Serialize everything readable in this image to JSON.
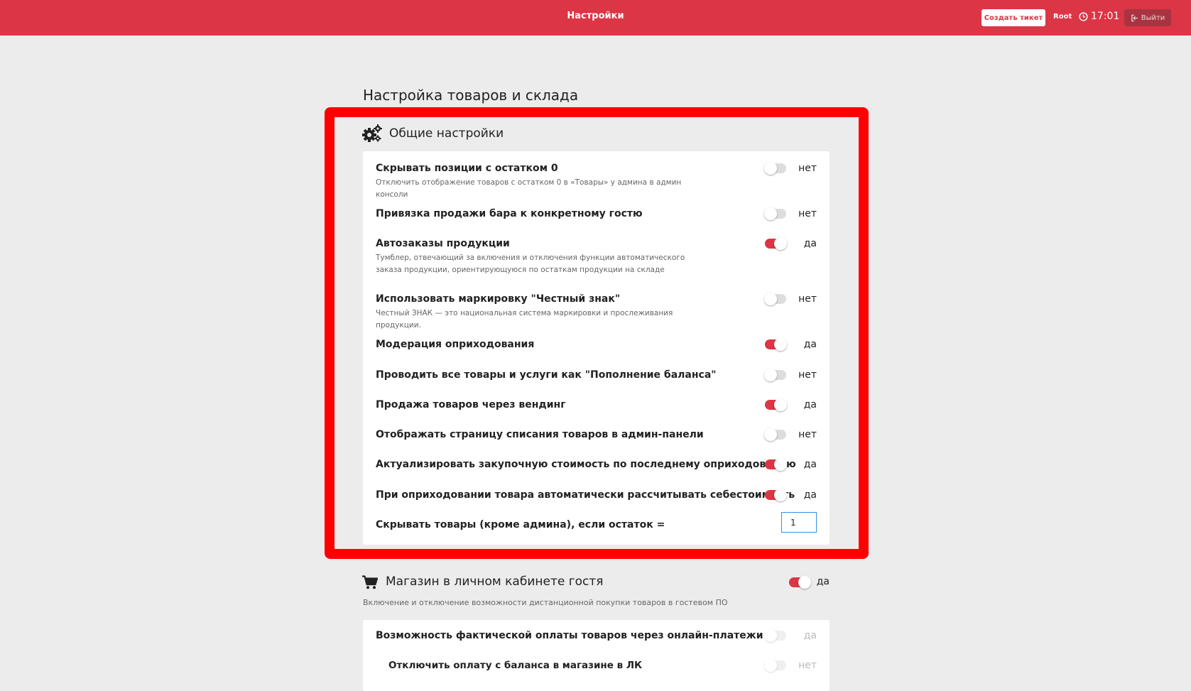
{
  "header": {
    "title": "Настройки",
    "create_ticket": "Создать тикет",
    "user": "Root",
    "time": "17:01",
    "logout": "Выйти"
  },
  "page_title": "Настройка товаров и склада",
  "general": {
    "title": "Общие настройки",
    "rows": [
      {
        "label": "Скрывать позиции с остатком 0",
        "desc": "Отключить отображение товаров с остатком 0 в «Товары» у админа в админ консоли",
        "state": "нет"
      },
      {
        "label": "Привязка продажи бара к конкретному гостю",
        "desc": "",
        "state": "нет"
      },
      {
        "label": "Автозаказы продукции",
        "desc": "Тумблер, отвечающий за включения и отключения функции автоматического заказа продукции, ориентирующуюся по остаткам продукции на складе",
        "state": "да"
      },
      {
        "label": "Использовать маркировку \"Честный знак\"",
        "desc": "Честный ЗНАК — это национальная система маркировки и прослеживания продукции.",
        "state": "нет"
      },
      {
        "label": "Модерация оприходования",
        "desc": "",
        "state": "да"
      },
      {
        "label": "Проводить все товары и услуги как \"Пополнение баланса\"",
        "desc": "",
        "state": "нет"
      },
      {
        "label": "Продажа товаров через вендинг",
        "desc": "",
        "state": "да"
      },
      {
        "label": "Отображать страницу списания товаров в админ-панели",
        "desc": "",
        "state": "нет"
      },
      {
        "label": "Актуализировать закупочную стоимость по последнему оприходованию",
        "desc": "",
        "state": "да"
      },
      {
        "label": "При оприходовании товара автоматически рассчитывать себестоимость",
        "desc": "",
        "state": "да"
      }
    ],
    "hide_threshold": {
      "label": "Скрывать товары (кроме админа), если остаток =",
      "value": "1"
    }
  },
  "shop": {
    "title": "Магазин в личном кабинете гостя",
    "state": "да",
    "desc": "Включение и отключение возможности дистанционной покупки товаров в гостевом ПО",
    "rows": [
      {
        "label": "Возможность фактической оплаты товаров через онлайн-платежи",
        "state": "да"
      },
      {
        "label": "Отключить оплату с баланса в магазине в ЛК",
        "state": "нет"
      }
    ]
  },
  "colors": {
    "accent": "#dc3545",
    "highlight": "#ff0000",
    "input_border": "#3a8dde"
  }
}
